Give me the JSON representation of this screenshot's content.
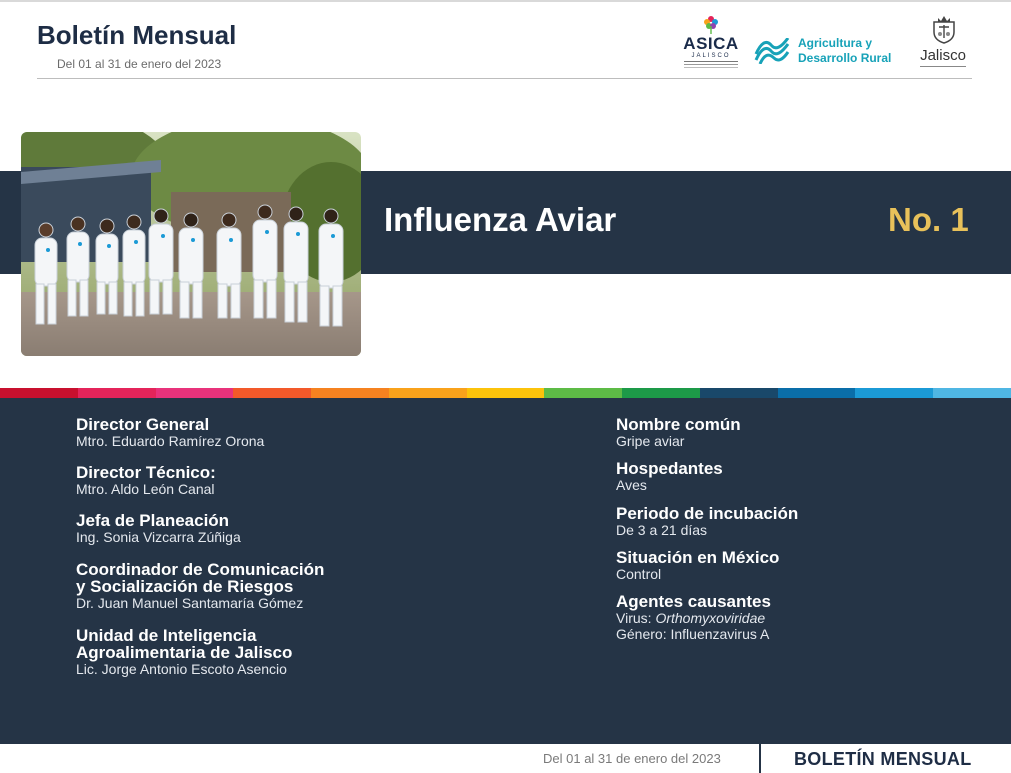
{
  "header": {
    "title": "Boletín Mensual",
    "date_range": "Del 01 al 31 de enero del 2023"
  },
  "logos": {
    "asica": {
      "word": "ASICA",
      "sub": "JALISCO"
    },
    "agricultura": {
      "line1": "Agricultura y",
      "line2": "Desarrollo Rural"
    },
    "jalisco": {
      "word": "Jalisco"
    }
  },
  "banner": {
    "title": "Influenza Aviar",
    "issue": "No. 1"
  },
  "stripe_colors": [
    "#c8102e",
    "#e4245a",
    "#e8327b",
    "#f2592a",
    "#f58220",
    "#f9a21b",
    "#fcc30b",
    "#5dbb46",
    "#1d9a48",
    "#19486a",
    "#0a6ea9",
    "#1b9ad6",
    "#4fb6e3"
  ],
  "credits": [
    {
      "label": "Director General",
      "value": "Mtro. Eduardo Ramírez Orona"
    },
    {
      "label": "Director Técnico:",
      "value": "Mtro. Aldo León Canal"
    },
    {
      "label": "Jefa de Planeación",
      "value": "Ing. Sonia Vizcarra Zúñiga"
    },
    {
      "label_line1": "Coordinador de Comunicación",
      "label_line2": "y Socialización de Riesgos",
      "value": "Dr. Juan Manuel Santamaría Gómez"
    },
    {
      "label_line1": "Unidad de Inteligencia",
      "label_line2": "Agroalimentaria de Jalisco",
      "value": "Lic. Jorge Antonio Escoto Asencio"
    }
  ],
  "disease_info": [
    {
      "label": "Nombre común",
      "value": "Gripe aviar"
    },
    {
      "label": "Hospedantes",
      "value": "Aves"
    },
    {
      "label": "Periodo de incubación",
      "value": "De 3 a 21 días"
    },
    {
      "label": "Situación en México",
      "value": "Control"
    },
    {
      "label": "Agentes causantes",
      "value_prefix": "Virus: ",
      "value_italic": "Orthomyxoviridae",
      "value2": "Género: Influenzavirus A"
    }
  ],
  "footer": {
    "date_range": "Del 01 al 31 de enero del 2023",
    "title": "BOLETÍN MENSUAL"
  }
}
